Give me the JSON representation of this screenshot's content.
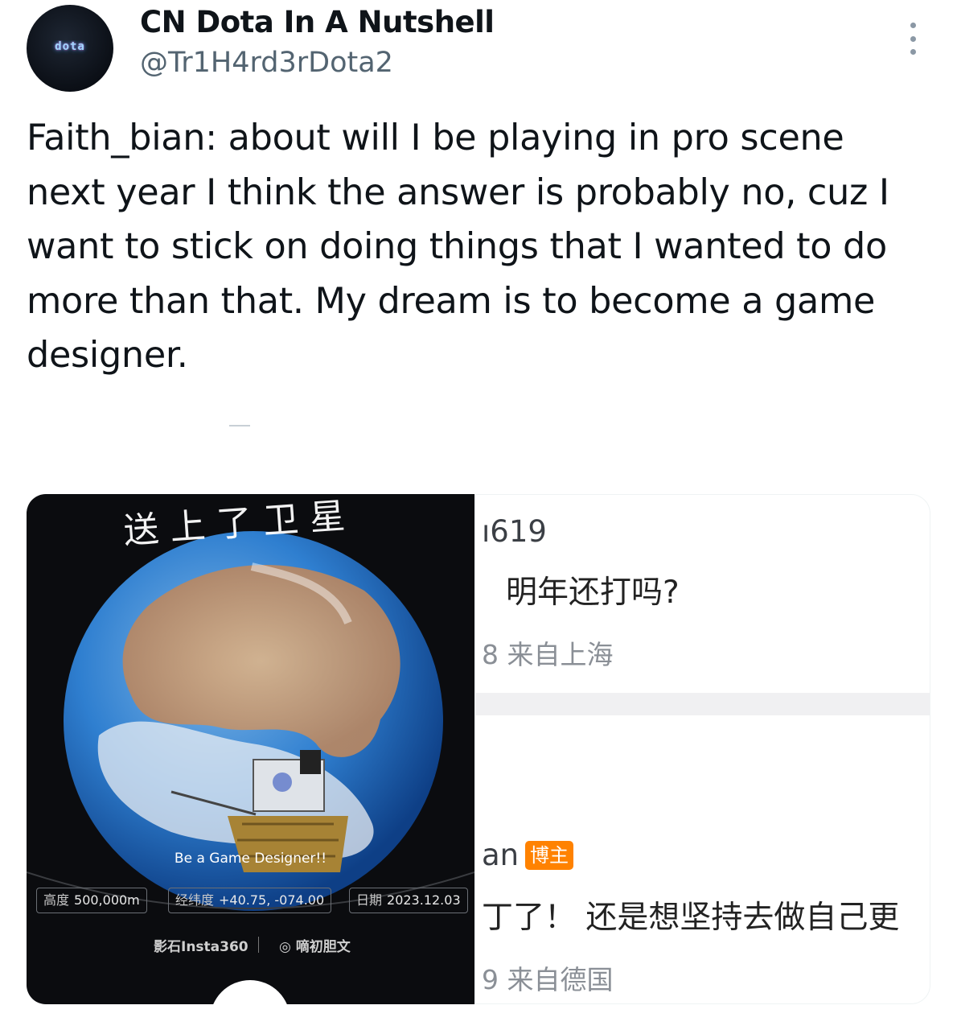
{
  "author": {
    "display_name": "CN Dota In A Nutshell",
    "handle": "@Tr1H4rd3rDota2",
    "avatar_text": "dota"
  },
  "tweet": {
    "lines": [
      "Faith_bian: about will I be playing in pro scene",
      "next year I think the answer is probably no, cuz I",
      "want to stick on doing things that I wanted to do",
      "more than that. My dream is to become a game",
      "designer."
    ]
  },
  "media": {
    "photo": {
      "handwriting": "送上了卫星",
      "caption": "Be a Game Designer!!",
      "altitude_label": "高度",
      "altitude_value": "500,000m",
      "coords_label": "经纬度",
      "coords_value": "+40.75, -074.00",
      "date_label": "日期",
      "date_value": "2023.12.03",
      "brand_left": "影石Insta360",
      "brand_right": "◎ 嘀初胆文"
    },
    "comments": [
      {
        "user": "ı619",
        "text": "明年还打吗?",
        "meta": "8  来自上海"
      },
      {
        "user": "an",
        "badge": "博主",
        "text": "丁了！ 还是想坚持去做自己更",
        "meta": "9  来自德国"
      }
    ]
  },
  "colors": {
    "badge": "#ff8200",
    "ocean": "#2f7fd0",
    "text_primary": "#0f1419",
    "text_secondary": "#536471"
  }
}
